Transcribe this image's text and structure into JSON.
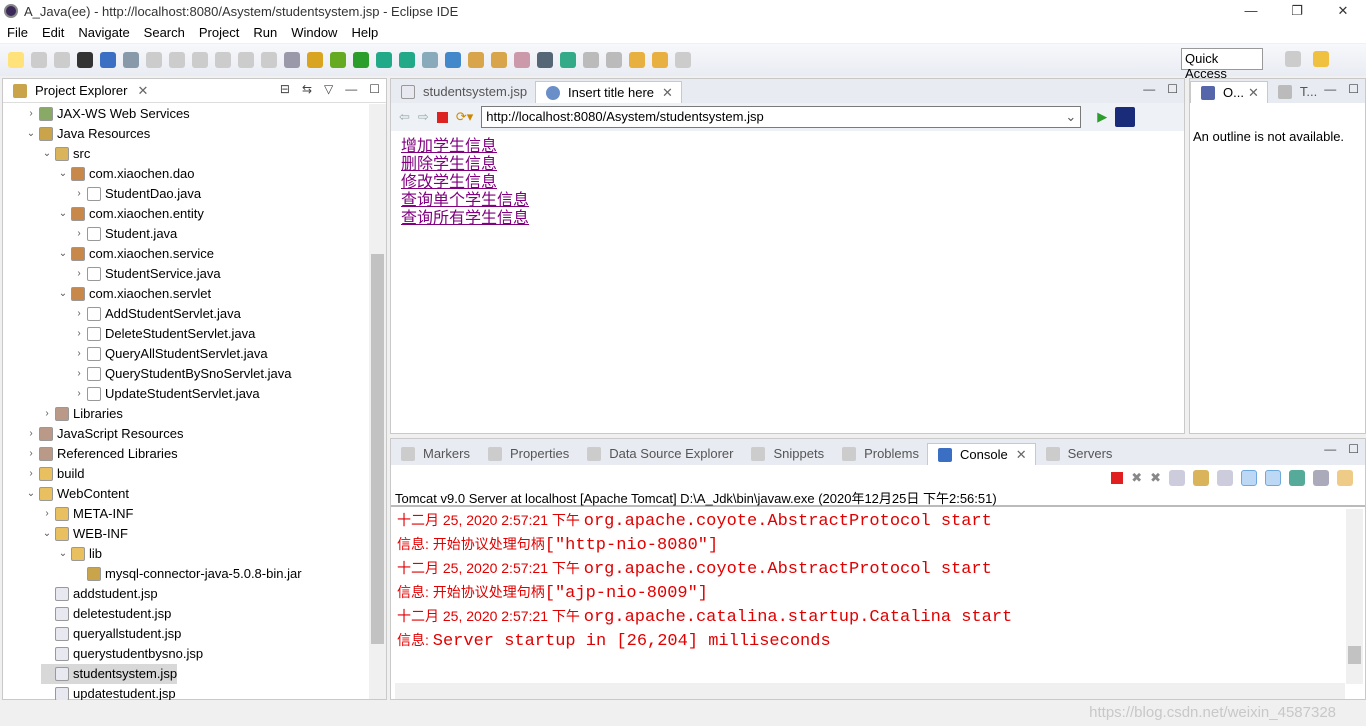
{
  "window": {
    "title": "A_Java(ee) - http://localhost:8080/Asystem/studentsystem.jsp - Eclipse IDE",
    "controls": [
      "—",
      "❐",
      "✕"
    ]
  },
  "menu": [
    "File",
    "Edit",
    "Navigate",
    "Search",
    "Project",
    "Run",
    "Window",
    "Help"
  ],
  "toolbar": {
    "quick_access": "Quick Access"
  },
  "project_explorer": {
    "title": "Project Explorer",
    "items": [
      {
        "label": "JAX-WS Web Services",
        "level": 1,
        "chev": "›",
        "icon": "webservice-icon"
      },
      {
        "label": "Java Resources",
        "level": 1,
        "chev": "⌄",
        "icon": "java-resources-icon"
      },
      {
        "label": "src",
        "level": 2,
        "chev": "⌄",
        "icon": "source-folder-icon"
      },
      {
        "label": "com.xiaochen.dao",
        "level": 3,
        "chev": "⌄",
        "icon": "package-icon"
      },
      {
        "label": "StudentDao.java",
        "level": 4,
        "chev": "›",
        "icon": "java-file-icon"
      },
      {
        "label": "com.xiaochen.entity",
        "level": 3,
        "chev": "⌄",
        "icon": "package-icon"
      },
      {
        "label": "Student.java",
        "level": 4,
        "chev": "›",
        "icon": "java-file-icon"
      },
      {
        "label": "com.xiaochen.service",
        "level": 3,
        "chev": "⌄",
        "icon": "package-icon"
      },
      {
        "label": "StudentService.java",
        "level": 4,
        "chev": "›",
        "icon": "java-file-icon"
      },
      {
        "label": "com.xiaochen.servlet",
        "level": 3,
        "chev": "⌄",
        "icon": "package-icon"
      },
      {
        "label": "AddStudentServlet.java",
        "level": 4,
        "chev": "›",
        "icon": "java-file-icon"
      },
      {
        "label": "DeleteStudentServlet.java",
        "level": 4,
        "chev": "›",
        "icon": "java-file-icon"
      },
      {
        "label": "QueryAllStudentServlet.java",
        "level": 4,
        "chev": "›",
        "icon": "java-file-icon"
      },
      {
        "label": "QueryStudentBySnoServlet.java",
        "level": 4,
        "chev": "›",
        "icon": "java-file-icon"
      },
      {
        "label": "UpdateStudentServlet.java",
        "level": 4,
        "chev": "›",
        "icon": "java-file-icon"
      },
      {
        "label": "Libraries",
        "level": 2,
        "chev": "›",
        "icon": "library-icon"
      },
      {
        "label": "JavaScript Resources",
        "level": 1,
        "chev": "›",
        "icon": "library-icon"
      },
      {
        "label": "Referenced Libraries",
        "level": 1,
        "chev": "›",
        "icon": "library-icon"
      },
      {
        "label": "build",
        "level": 1,
        "chev": "›",
        "icon": "folder-icon"
      },
      {
        "label": "WebContent",
        "level": 1,
        "chev": "⌄",
        "icon": "folder-icon"
      },
      {
        "label": "META-INF",
        "level": 2,
        "chev": "›",
        "icon": "folder-icon"
      },
      {
        "label": "WEB-INF",
        "level": 2,
        "chev": "⌄",
        "icon": "folder-icon"
      },
      {
        "label": "lib",
        "level": 3,
        "chev": "⌄",
        "icon": "folder-icon"
      },
      {
        "label": "mysql-connector-java-5.0.8-bin.jar",
        "level": 4,
        "chev": "",
        "icon": "jar-icon"
      },
      {
        "label": "addstudent.jsp",
        "level": 2,
        "chev": "",
        "icon": "jsp-file-icon"
      },
      {
        "label": "deletestudent.jsp",
        "level": 2,
        "chev": "",
        "icon": "jsp-file-icon"
      },
      {
        "label": "queryallstudent.jsp",
        "level": 2,
        "chev": "",
        "icon": "jsp-file-icon"
      },
      {
        "label": "querystudentbysno.jsp",
        "level": 2,
        "chev": "",
        "icon": "jsp-file-icon"
      },
      {
        "label": "studentsystem.jsp",
        "level": 2,
        "chev": "",
        "icon": "jsp-file-icon",
        "selected": true
      },
      {
        "label": "updatestudent.jsp",
        "level": 2,
        "chev": "",
        "icon": "jsp-file-icon"
      }
    ]
  },
  "editor": {
    "tabs": [
      {
        "label": "studentsystem.jsp",
        "active": false
      },
      {
        "label": "Insert title here",
        "active": true
      }
    ],
    "url": "http://localhost:8080/Asystem/studentsystem.jsp",
    "links": [
      "增加学生信息",
      "删除学生信息",
      "修改学生信息",
      "查询单个学生信息",
      "查询所有学生信息"
    ]
  },
  "outline": {
    "tabs": [
      "O...",
      "T..."
    ],
    "message": "An outline is not available."
  },
  "bottom": {
    "tabs": [
      "Markers",
      "Properties",
      "Data Source Explorer",
      "Snippets",
      "Problems",
      "Console",
      "Servers"
    ],
    "active": "Console",
    "console_header": "Tomcat v9.0 Server at localhost [Apache Tomcat] D:\\A_Jdk\\bin\\javaw.exe (2020年12月25日 下午2:56:51)",
    "lines": [
      {
        "cj": "十二月 25, 2020 2:57:21 下午 ",
        "mono": "org.apache.coyote.AbstractProtocol start"
      },
      {
        "cj": "信息: 开始协议处理句柄",
        "mono": "[\"http-nio-8080\"]"
      },
      {
        "cj": "十二月 25, 2020 2:57:21 下午 ",
        "mono": "org.apache.coyote.AbstractProtocol start"
      },
      {
        "cj": "信息: 开始协议处理句柄",
        "mono": "[\"ajp-nio-8009\"]"
      },
      {
        "cj": "十二月 25, 2020 2:57:21 下午 ",
        "mono": "org.apache.catalina.startup.Catalina start"
      },
      {
        "cj": "信息: ",
        "mono": "Server startup in [26,204] milliseconds"
      }
    ]
  },
  "watermark": "https://blog.csdn.net/weixin_4587328"
}
